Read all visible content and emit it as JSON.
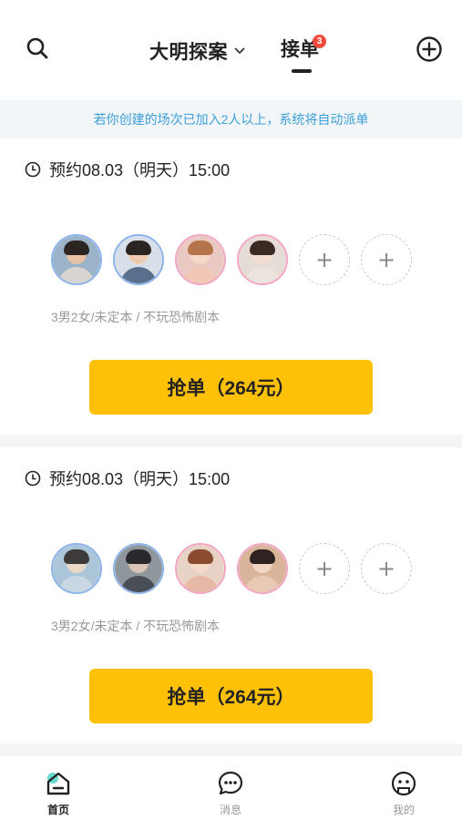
{
  "header": {
    "title": "大明探案",
    "tab_label": "接单",
    "tab_badge": "3",
    "icons": {
      "search": "search-icon",
      "add": "add-circle-icon",
      "chevron": "chevron-down-icon"
    }
  },
  "notice": "若你创建的场次已加入2人以上，系统将自动派单",
  "orders": [
    {
      "time": "预约08.03（明天）15:00",
      "players": [
        {
          "gender": "male",
          "skin": "#e7c2a4",
          "hair": "#2b2420",
          "shirt": "#d9d4cf",
          "bg": "#9bb3c9"
        },
        {
          "gender": "male",
          "skin": "#eccbb0",
          "hair": "#2a2522",
          "shirt": "#5a6f8d",
          "bg": "#d8dfe8"
        },
        {
          "gender": "female",
          "skin": "#f4d9c7",
          "hair": "#b5744a",
          "shirt": "#f0c7b4",
          "bg": "#e9c9c1"
        },
        {
          "gender": "female",
          "skin": "#f4ddd0",
          "hair": "#3b2a24",
          "shirt": "#ece3dd",
          "bg": "#e6dcd6"
        }
      ],
      "empty_slots": [
        "+",
        "+"
      ],
      "desc": "3男2女/未定本 / 不玩恐怖剧本",
      "button_label": "抢单（264元）"
    },
    {
      "time": "预约08.03（明天）15:00",
      "players": [
        {
          "gender": "male",
          "skin": "#ead8c9",
          "hair": "#3d3a3a",
          "shirt": "#c9d6e3",
          "bg": "#aac6d8"
        },
        {
          "gender": "male",
          "skin": "#d9c4b6",
          "hair": "#2a2a2e",
          "shirt": "#4a4f57",
          "bg": "#8f969c"
        },
        {
          "gender": "female",
          "skin": "#f5d8c8",
          "hair": "#8a4b2e",
          "shirt": "#e6b9a6",
          "bg": "#e8d2c6"
        },
        {
          "gender": "female",
          "skin": "#f0d5c6",
          "hair": "#2e2320",
          "shirt": "#e8c9b4",
          "bg": "#d9b39a"
        }
      ],
      "empty_slots": [
        "+",
        "+"
      ],
      "desc": "3男2女/未定本 / 不玩恐怖剧本",
      "button_label": "抢单（264元）"
    }
  ],
  "nav": {
    "items": [
      {
        "label": "首页",
        "icon": "home-icon",
        "active": true
      },
      {
        "label": "消息",
        "icon": "message-icon",
        "active": false
      },
      {
        "label": "我的",
        "icon": "profile-icon",
        "active": false
      }
    ],
    "accent": "#4fd1c5"
  },
  "colors": {
    "button": "#ffc107",
    "notice_text": "#3a9fd8",
    "badge": "#f04a3c"
  }
}
